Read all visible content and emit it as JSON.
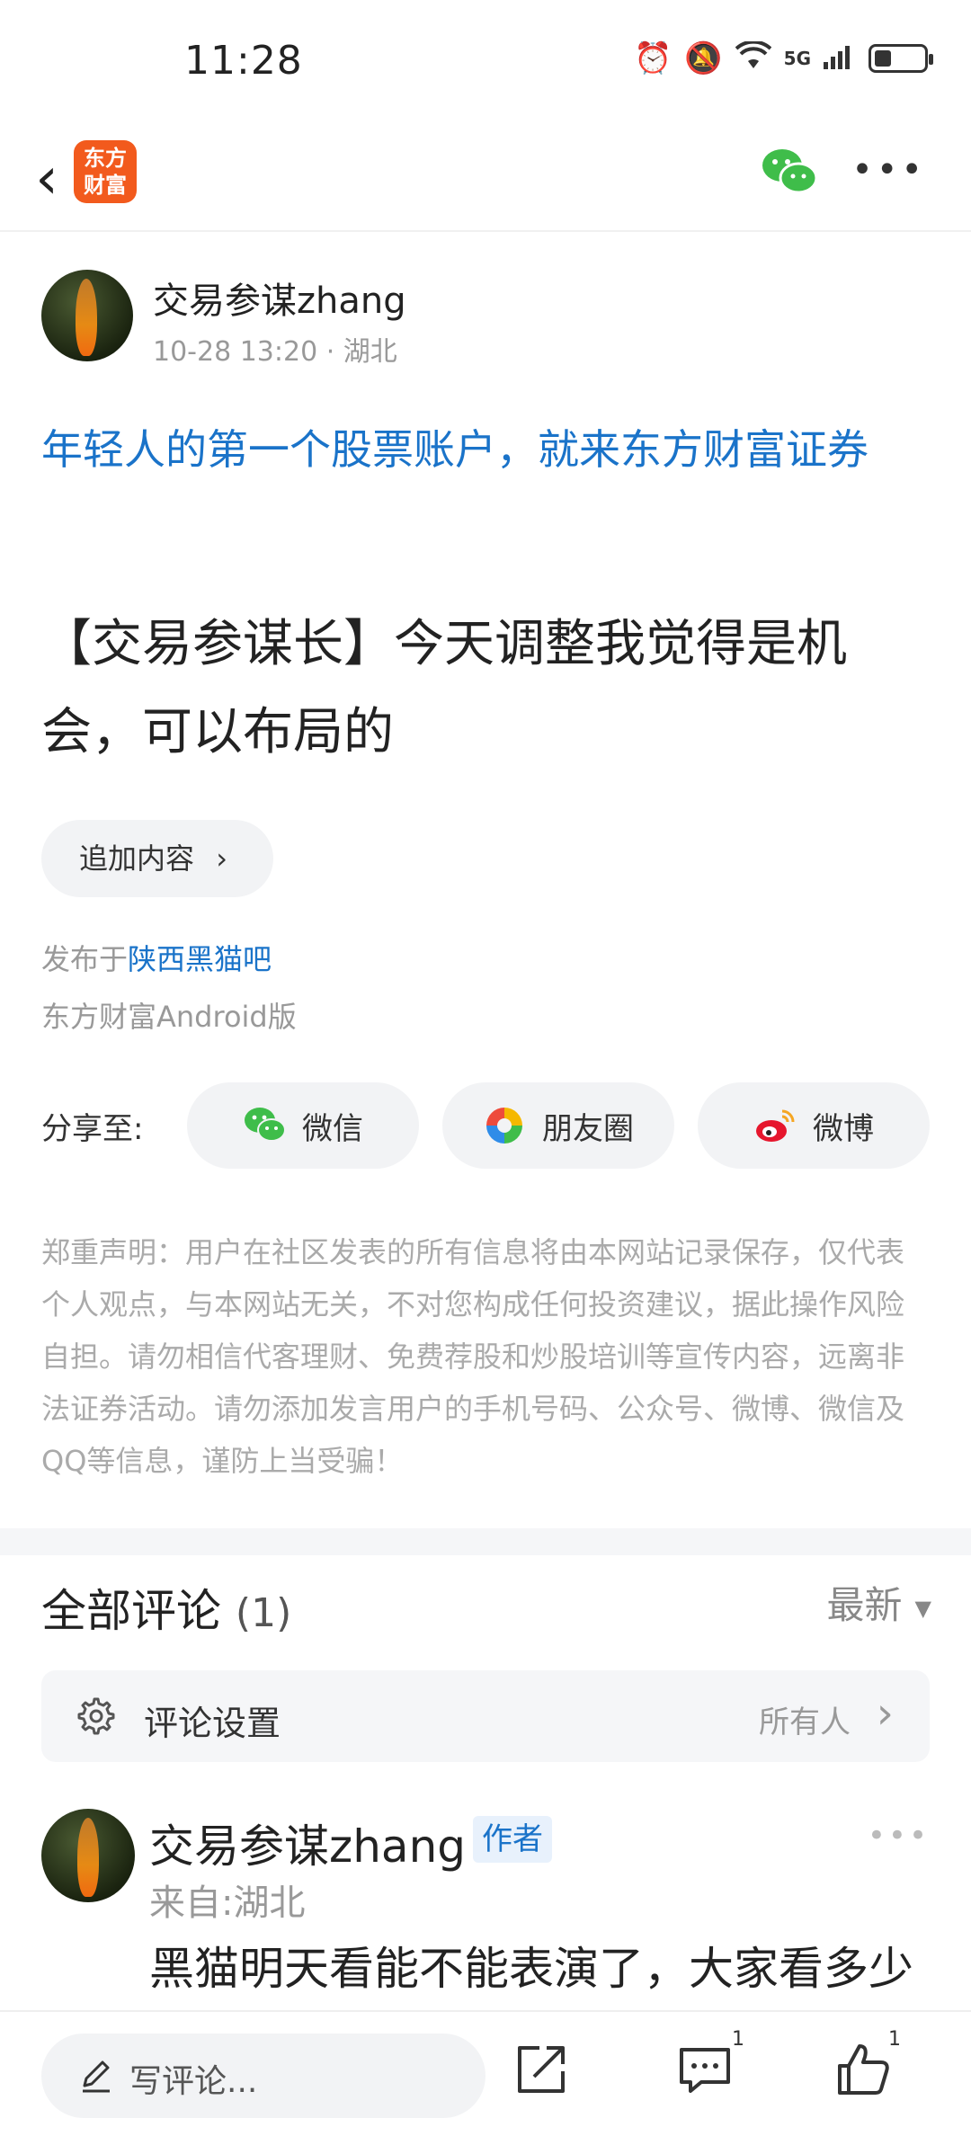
{
  "status": {
    "time": "11:28",
    "network": "5G"
  },
  "header": {
    "logo_text": "东方财富",
    "colors": {
      "brand": "#f25a1d",
      "wechat": "#3fbd4a",
      "link": "#1a73c9"
    }
  },
  "post": {
    "author": "交易参谋zhang",
    "time": "10-28 13:20",
    "location": "湖北",
    "promo": "年轻人的第一个股票账户，就来东方财富证券",
    "title": "【交易参谋长】今天调整我觉得是机会，可以布局的",
    "append_button": "追加内容",
    "publish_prefix": "发布于",
    "board": "陕西黑猫吧",
    "client": "东方财富Android版"
  },
  "share": {
    "label": "分享至:",
    "wechat": "微信",
    "moments": "朋友圈",
    "weibo": "微博"
  },
  "disclaimer": "郑重声明：用户在社区发表的所有信息将由本网站记录保存，仅代表个人观点，与本网站无关，不对您构成任何投资建议，据此操作风险自担。请勿相信代客理财、免费荐股和炒股培训等宣传内容，远离非法证券活动。请勿添加发言用户的手机号码、公众号、微博、微信及QQ等信息，谨防上当受骗！",
  "comments": {
    "title": "全部评论",
    "count": "(1)",
    "sort": "最新",
    "settings_label": "评论设置",
    "settings_value": "所有人",
    "items": [
      {
        "author": "交易参谋zhang",
        "badge": "作者",
        "from": "来自:湖北",
        "text": "黑猫明天看能不能表演了，大家看多少"
      }
    ]
  },
  "bottom": {
    "input_placeholder": "写评论...",
    "comment_count": "1",
    "like_count": "1"
  }
}
